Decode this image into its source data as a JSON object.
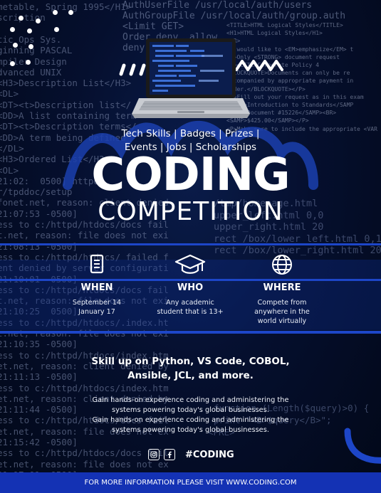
{
  "hero": {
    "tagline_line1": "Tech Skills | Badges | Prizes |",
    "tagline_line2": "Events | Jobs | Scholarships",
    "title": "CODING",
    "subtitle": "COMPETITION"
  },
  "info": {
    "when": {
      "icon": "document-icon",
      "heading": "WHEN",
      "line1": "September 14",
      "line2": "January 17"
    },
    "who": {
      "icon": "graduation-cap-icon",
      "heading": "WHO",
      "line1": "Any academic",
      "line2": "student that is 13+"
    },
    "where": {
      "icon": "globe-icon",
      "heading": "WHERE",
      "line1": "Compete from",
      "line2": "anywhere in the",
      "line3": "world virtually"
    }
  },
  "skills": {
    "headline_line1": "Skill up on Python, VS Code, COBOL,",
    "headline_line2": "Ansible, JCL, and more.",
    "desc1_line1": "Gain hands-on experience coding and administering the",
    "desc1_line2": "systems powering today's global businesses.",
    "desc2_line1": "Gain hands-on experience coding and administering the",
    "desc2_line2": "systems powering today's global businesses."
  },
  "social": {
    "instagram_icon": "instagram-icon",
    "facebook_icon": "facebook-icon",
    "hashtag": "#CODING"
  },
  "footer": {
    "text": "FOR MORE INFORMATION PLEASE VISIT WWW.CODING.COM"
  },
  "colors": {
    "accent_blue": "#1d46c8",
    "footer_blue": "#1432b4",
    "background": "#050f2e"
  },
  "background_code": {
    "left": [
      "metable, Spring 1995</H1>",
      "scription",
      "",
      "tic Ops Sys.",
      "ginning PASCAL",
      "mpiler Design",
      "dvanced UNIX",
      "<H3>Description List</H3>",
      "<DL>",
      "<DT><t>Description list</",
      "<DD>A list containing term",
      "<DT><t>Description terms</",
      "<DD>A term being defined",
      "</DL>",
      "<H3>Ordered List</H3>",
      "<OL>",
      "21:02:  0500] httpd: ",
      "r/tpddoc/setup",
      "fonet.net, reason: client denied by server",
      "21:07:53 -0500]",
      "ess to c:/httpd/htdocs/docs failed for",
      "t.net, reason: file does not exist",
      "21:08:13 -0500]",
      "ess to c:/httpd/htdocs/ failed for",
      "ent denied by server configuration",
      "21:10:01 -0500]",
      "ess to c:/httpd/htdocs/docs failed for",
      "t.net, reason: file does not exist",
      "21:10:25  0500]",
      "ess to c:/httpd/htdocs/.index.html failed for",
      "t.net, reason: file does not exist",
      "21:10:35 -0500]",
      "ess to c:/httpd/htdocs/index.htm failed for",
      "et.net, reason: client denied by",
      "21:11:13 -0500]",
      "ess to c:/httpd/htdocs/index.htm failed for",
      "et.net, reason: client denied by server configuration",
      "21:11:44 -0500]",
      "ess to c:/httpd/htdocs/docs failed for",
      "et.net, reason: file does not exist",
      "21:15:42 -0500]",
      "ess to c:/httpd/htdocs/docs failed for",
      "et.net, reason: file does not exist",
      "21:17:01 -0500]"
    ],
    "top": [
      "AuthUserFile /usr/local/auth/users",
      "AuthGroupFile /usr/local/auth/group.auth",
      "<Limit GET>",
      "Order deny, allow",
      "deny from all"
    ],
    "right": [
      "<TITLE>HTML Logical Styles</TITLE>",
      "<H1>HTML Logical Styles</H1>",
      "<HR>",
      "We would like to <EM>emphasize</EM> t",
      "<P>Only <STRONG> document request",
      "<P><CITE>Corporate Policy 4",
      "<BLOCKQUOTE>Documents can only be re",
      "accompanied by appropriate payment in",
      "order.</BLOCKQUOTE></P>",
      "<P>Fill out your request as in this exam",
      "<SAMP>Introduction to Standards</SAMP",
      "<SAMP>Document #15226</SAMP><BR>",
      "<SAMP>$425.00</SAMP></P>",
      "<P>Make sure to include the appropriate <VAR"
    ],
    "mid": [
      "/tmp/homepage.html",
      "upper_left.html 0,0",
      "upper_right.html 20",
      "rect /box/lower_left.html 0,1",
      "rect /box/lower_right.html 20"
    ],
    "low": [
      "function (Length($query)>0) {",
      "print \"<B>$query</B>\";",
      "<PRE>"
    ]
  }
}
